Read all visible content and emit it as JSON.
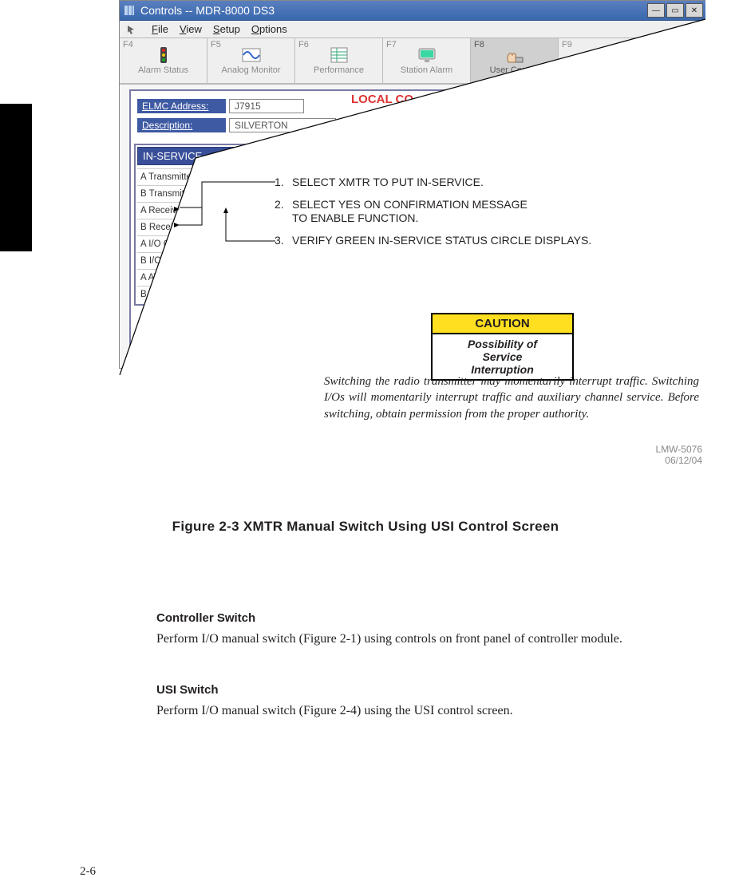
{
  "window": {
    "title": "Controls -- MDR-8000 DS3",
    "menus": {
      "file": "File",
      "view": "View",
      "setup": "Setup",
      "options": "Options"
    }
  },
  "toolbar": [
    {
      "fkey": "F4",
      "label": "Alarm Status"
    },
    {
      "fkey": "F5",
      "label": "Analog Monitor"
    },
    {
      "fkey": "F6",
      "label": "Performance"
    },
    {
      "fkey": "F7",
      "label": "Station Alarm"
    },
    {
      "fkey": "F8",
      "label": "User Control"
    },
    {
      "fkey": "F9",
      "label": ""
    }
  ],
  "form": {
    "section_title": "LOCAL CO",
    "elmc_label": "ELMC Address:",
    "elmc_value": "J7915",
    "desc_label": "Description:",
    "desc_value": "SILVERTON"
  },
  "panel": {
    "header": "IN-SERVICE",
    "rows": [
      {
        "label": "A Transmitter On Line",
        "on": true
      },
      {
        "label": "B Transmitter On Line",
        "on": false
      },
      {
        "label": "A Receiver On Line",
        "on": true
      },
      {
        "label": "B Receiver On Line",
        "on": false
      },
      {
        "label": "A I/O On Line",
        "on": true
      },
      {
        "label": "B I/O On Line",
        "on": false
      },
      {
        "label": "A ATPC HIGH Power Lock",
        "on": false
      },
      {
        "label": "B ATPC HIGH Power Lock",
        "on": false
      }
    ]
  },
  "steps": {
    "s1": "SELECT XMTR TO PUT IN-SERVICE.",
    "s2a": "SELECT YES ON CONFIRMATION MESSAGE",
    "s2b": "TO ENABLE FUNCTION.",
    "s3": "VERIFY GREEN IN-SERVICE STATUS CIRCLE DISPLAYS."
  },
  "caution": {
    "title": "CAUTION",
    "line1": "Possibility of",
    "line2": "Service",
    "line3": "Interruption"
  },
  "caution_para": "Switching the radio transmitter may momentarily interrupt traffic. Switching I/Os will momentarily interrupt traffic and auxiliary channel service. Before switching, obtain permission from the proper authority.",
  "doc": {
    "num": "LMW-5076",
    "date": "06/12/04"
  },
  "figure_caption": "Figure 2-3  XMTR Manual Switch Using USI Control Screen",
  "sections": {
    "h1": "Controller Switch",
    "p1": "Perform I/O manual switch (Figure 2-1) using controls on front panel of controller module.",
    "h2": "USI Switch",
    "p2": "Perform I/O manual switch (Figure 2-4) using the USI control screen."
  },
  "page_number": "2-6"
}
